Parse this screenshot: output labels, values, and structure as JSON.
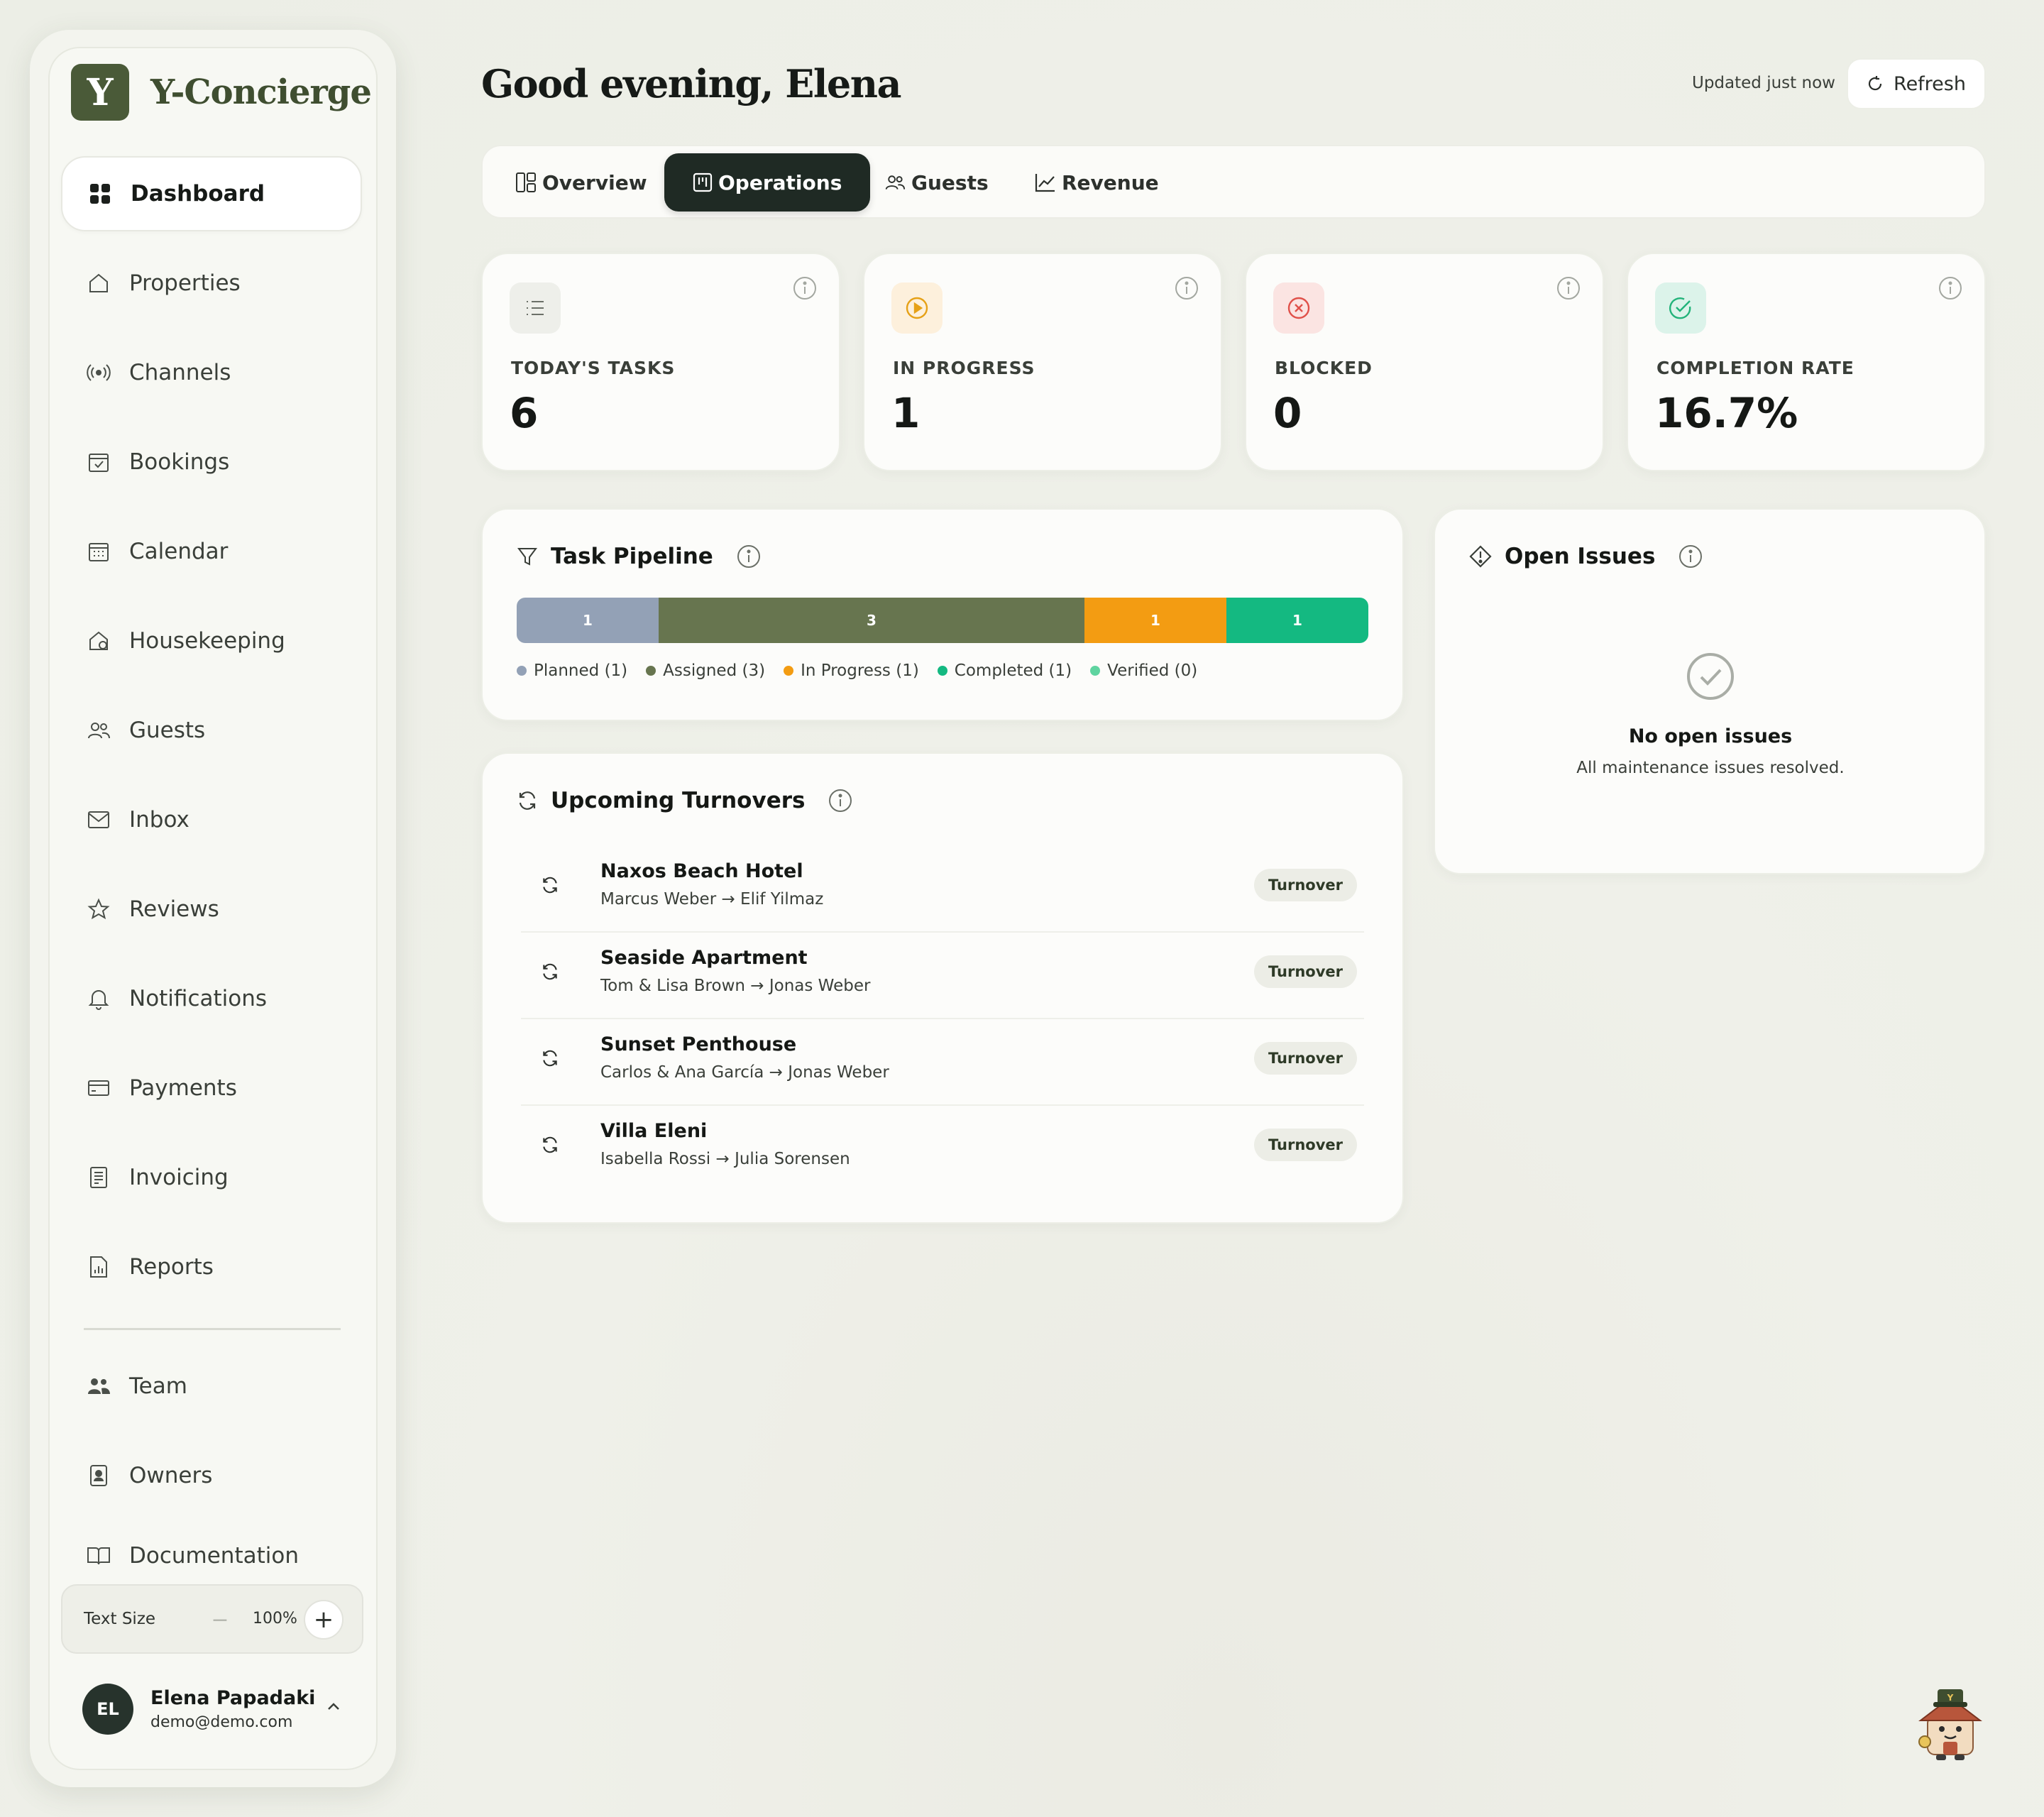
{
  "brand": {
    "logo_letter": "Y",
    "name": "Y-Concierge",
    "color": "#4a5a38"
  },
  "sidebar": {
    "items": [
      {
        "label": "Dashboard",
        "icon": "grid-icon",
        "active": true
      },
      {
        "label": "Properties",
        "icon": "home-icon"
      },
      {
        "label": "Channels",
        "icon": "broadcast-icon"
      },
      {
        "label": "Bookings",
        "icon": "calendar-check-icon"
      },
      {
        "label": "Calendar",
        "icon": "calendar-icon"
      },
      {
        "label": "Housekeeping",
        "icon": "home-gear-icon"
      },
      {
        "label": "Guests",
        "icon": "users-icon"
      },
      {
        "label": "Inbox",
        "icon": "mail-icon"
      },
      {
        "label": "Reviews",
        "icon": "star-icon"
      },
      {
        "label": "Notifications",
        "icon": "bell-icon"
      },
      {
        "label": "Payments",
        "icon": "card-icon"
      },
      {
        "label": "Invoicing",
        "icon": "receipt-icon"
      },
      {
        "label": "Reports",
        "icon": "report-icon"
      }
    ],
    "secondary": [
      {
        "label": "Team",
        "icon": "team-icon"
      },
      {
        "label": "Owners",
        "icon": "owner-icon"
      },
      {
        "label": "Documentation",
        "icon": "book-icon"
      }
    ],
    "text_size": {
      "label": "Text Size",
      "value": "100%",
      "minus": "−",
      "plus": "+"
    },
    "user": {
      "initials": "EL",
      "name": "Elena Papadaki",
      "email": "demo@demo.com"
    }
  },
  "header": {
    "greeting": "Good evening, Elena",
    "updated": "Updated just now",
    "refresh_label": "Refresh"
  },
  "tabs": [
    {
      "label": "Overview",
      "icon": "layout-icon"
    },
    {
      "label": "Operations",
      "icon": "kanban-icon",
      "active": true
    },
    {
      "label": "Guests",
      "icon": "users-icon"
    },
    {
      "label": "Revenue",
      "icon": "trend-icon"
    }
  ],
  "stats": [
    {
      "label": "TODAY'S TASKS",
      "value": "6",
      "icon": "list-icon",
      "icon_bg": "#eeefea",
      "icon_color": "#6b7068"
    },
    {
      "label": "IN PROGRESS",
      "value": "1",
      "icon": "play-icon",
      "icon_bg": "#fdf0dc",
      "icon_color": "#e6a117"
    },
    {
      "label": "BLOCKED",
      "value": "0",
      "icon": "x-circle-icon",
      "icon_bg": "#fbe4e2",
      "icon_color": "#e0514a"
    },
    {
      "label": "COMPLETION RATE",
      "value": "16.7%",
      "icon": "check-circle-icon",
      "icon_bg": "#dcf3ea",
      "icon_color": "#22b37a"
    }
  ],
  "pipeline": {
    "title": "Task Pipeline",
    "segments": [
      {
        "value": 1,
        "label": "1",
        "color": "#93a1b6"
      },
      {
        "value": 3,
        "label": "3",
        "color": "#67754f"
      },
      {
        "value": 1,
        "label": "1",
        "color": "#f39c12"
      },
      {
        "value": 1,
        "label": "1",
        "color": "#14b981"
      }
    ],
    "legend": [
      {
        "label": "Planned (1)",
        "color": "#93a1b6"
      },
      {
        "label": "Assigned (3)",
        "color": "#67754f"
      },
      {
        "label": "In Progress (1)",
        "color": "#f39c12"
      },
      {
        "label": "Completed (1)",
        "color": "#14b981"
      },
      {
        "label": "Verified (0)",
        "color": "#5fd4a0"
      }
    ]
  },
  "turnovers": {
    "title": "Upcoming Turnovers",
    "items": [
      {
        "name": "Naxos Beach Hotel",
        "sub": "Marcus Weber → Elif Yilmaz",
        "badge": "Turnover"
      },
      {
        "name": "Seaside Apartment",
        "sub": "Tom & Lisa Brown → Jonas Weber",
        "badge": "Turnover"
      },
      {
        "name": "Sunset Penthouse",
        "sub": "Carlos & Ana García → Jonas Weber",
        "badge": "Turnover"
      },
      {
        "name": "Villa Eleni",
        "sub": "Isabella Rossi → Julia Sorensen",
        "badge": "Turnover"
      }
    ]
  },
  "issues": {
    "title": "Open Issues",
    "empty_title": "No open issues",
    "empty_sub": "All maintenance issues resolved."
  }
}
